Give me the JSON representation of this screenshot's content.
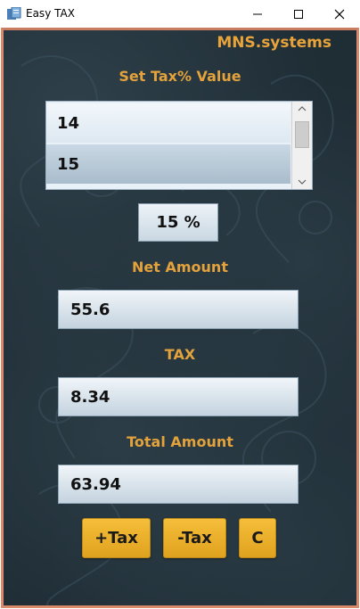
{
  "window": {
    "title": "Easy TAX",
    "minimize_glyph": "—",
    "maximize_glyph": "☐",
    "close_glyph": "✕"
  },
  "brand": "MNS.systems",
  "tax_list": {
    "label": "Set Tax% Value",
    "items": [
      "14",
      "15"
    ],
    "selected": "15"
  },
  "percent_display": "15 %",
  "net_amount": {
    "label": "Net Amount",
    "value": "55.6"
  },
  "tax": {
    "label": "TAX",
    "value": "8.34"
  },
  "total_amount": {
    "label": "Total Amount",
    "value": "63.94"
  },
  "buttons": {
    "add_tax": "+Tax",
    "remove_tax": "-Tax",
    "clear": "C"
  },
  "colors": {
    "accent_label": "#e3a23c",
    "button": "#f0b52e",
    "background": "#1f2d35",
    "border": "#d88a6a"
  }
}
